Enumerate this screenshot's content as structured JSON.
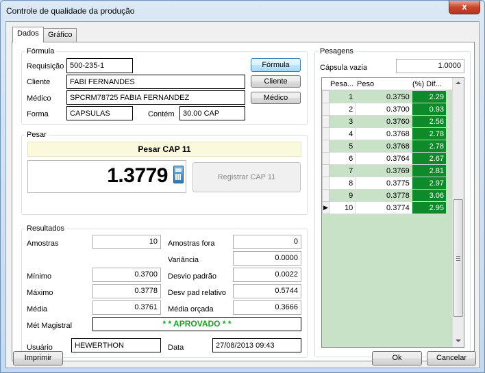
{
  "window": {
    "title": "Controle de qualidade da produção",
    "close_glyph": "x"
  },
  "tabs": [
    {
      "label": "Dados"
    },
    {
      "label": "Gráfico"
    }
  ],
  "formula": {
    "group_title": "Fórmula",
    "requisicao_label": "Requisição",
    "requisicao_value": "500-235-1",
    "cliente_label": "Cliente",
    "cliente_value": "FABI FERNANDES",
    "medico_label": "Médico",
    "medico_value": "SPCRM78725 FABIA FERNANDEZ",
    "forma_label": "Forma",
    "forma_value": "CAPSULAS",
    "contem_label": "Contém",
    "contem_value": "30.00 CAP",
    "btn_formula": "Fórmula",
    "btn_cliente": "Cliente",
    "btn_medico": "Médico"
  },
  "pesar": {
    "group_title": "Pesar",
    "banner": "Pesar CAP 11",
    "reading": "1.3779",
    "register_button": "Registrar CAP 11"
  },
  "resultados": {
    "group_title": "Resultados",
    "amostras_label": "Amostras",
    "amostras_value": "10",
    "amostras_fora_label": "Amostras fora",
    "amostras_fora_value": "0",
    "variancia_label": "Variância",
    "variancia_value": "0.0000",
    "minimo_label": "Mínimo",
    "minimo_value": "0.3700",
    "desvio_label": "Desvio padrão",
    "desvio_value": "0.0022",
    "maximo_label": "Máximo",
    "maximo_value": "0.3778",
    "desvio_rel_label": "Desv pad relativo",
    "desvio_rel_value": "0.5744",
    "media_label": "Média",
    "media_value": "0.3761",
    "media_orcada_label": "Média orçada",
    "media_orcada_value": "0.3666",
    "met_label": "Mét Magistral",
    "met_value": "* * APROVADO * *",
    "usuario_label": "Usuário",
    "usuario_value": "HEWERTHON",
    "data_label": "Data",
    "data_value": "27/08/2013 09:43"
  },
  "pesagens": {
    "group_title": "Pesagens",
    "capsula_label": "Cápsula vazia",
    "capsula_value": "1.0000",
    "columns": [
      "Pesa...",
      "Peso",
      "(%) Dif..."
    ],
    "rows": [
      {
        "n": "1",
        "peso": "0.3750",
        "dif": "2.29"
      },
      {
        "n": "2",
        "peso": "0.3700",
        "dif": "0.93"
      },
      {
        "n": "3",
        "peso": "0.3760",
        "dif": "2.56"
      },
      {
        "n": "4",
        "peso": "0.3768",
        "dif": "2.78"
      },
      {
        "n": "5",
        "peso": "0.3768",
        "dif": "2.78"
      },
      {
        "n": "6",
        "peso": "0.3764",
        "dif": "2.67"
      },
      {
        "n": "7",
        "peso": "0.3769",
        "dif": "2.81"
      },
      {
        "n": "8",
        "peso": "0.3775",
        "dif": "2.97"
      },
      {
        "n": "9",
        "peso": "0.3778",
        "dif": "3.06"
      },
      {
        "n": "10",
        "peso": "0.3774",
        "dif": "2.95"
      }
    ],
    "current_row_glyph": "▶"
  },
  "footer": {
    "imprimir": "Imprimir",
    "ok": "Ok",
    "cancelar": "Cancelar"
  },
  "colors": {
    "ok_green": "#0f8a2a",
    "row_alt": "#c8e2c8",
    "approved_text": "#13a321"
  }
}
